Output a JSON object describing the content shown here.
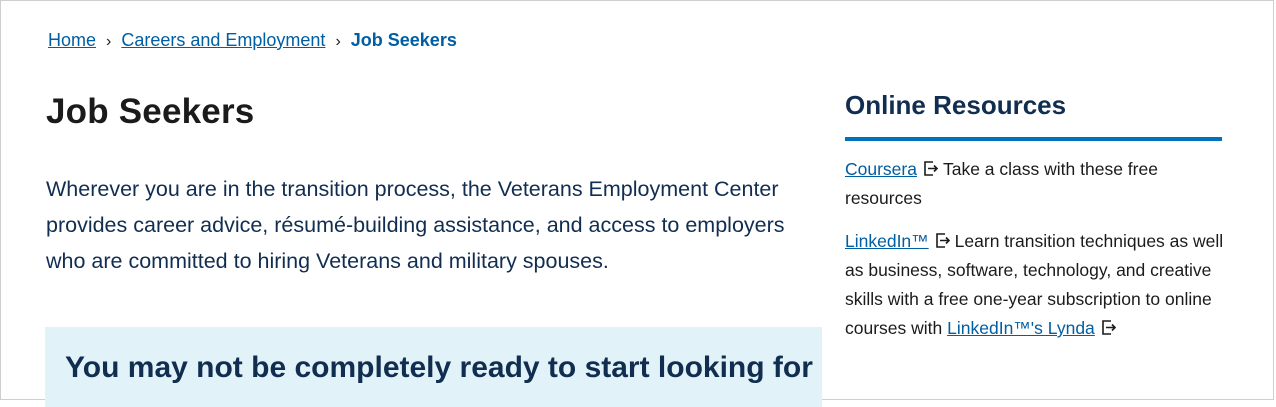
{
  "breadcrumb": {
    "home": "Home",
    "careers": "Careers and Employment",
    "current": "Job Seekers",
    "separator": "›"
  },
  "main": {
    "title": "Job Seekers",
    "intro": "Wherever you are in the transition process, the Veterans Employment Center provides career advice, résumé-building assistance, and access to employers who are committed to hiring Veterans and military spouses.",
    "callout_heading": "You may not be completely ready to start looking for"
  },
  "sidebar": {
    "title": "Online Resources",
    "items": [
      {
        "link": "Coursera",
        "text": "Take a class with these free resources",
        "icon": "external-link-icon"
      },
      {
        "link": "LinkedIn™",
        "text": "Learn transition techniques as well as business, software, technology, and creative skills with a free one-year subscription to online courses with",
        "link2": "LinkedIn™'s Lynda",
        "icon": "external-link-icon"
      }
    ]
  },
  "colors": {
    "link": "#005ea2",
    "heading": "#112e51",
    "accent_rule": "#0071bc",
    "callout_bg": "#e1f3f8"
  }
}
